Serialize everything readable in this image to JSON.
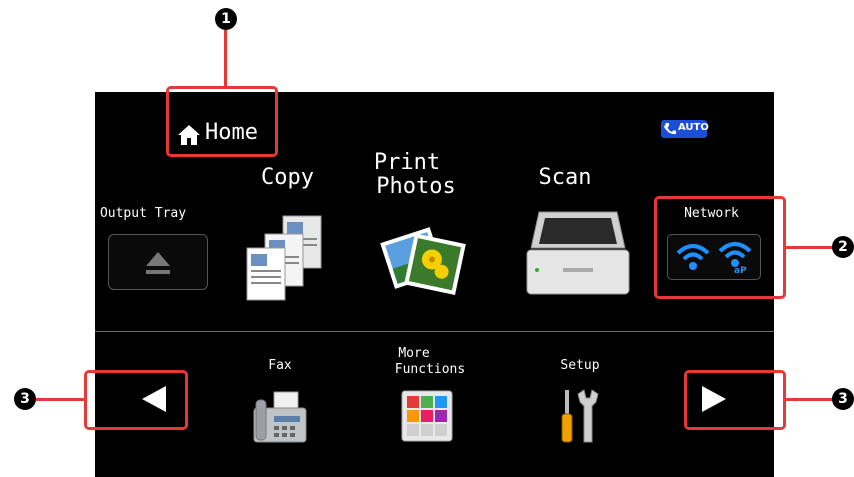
{
  "home": {
    "label": "Home"
  },
  "auto_badge": "AUTO",
  "output_tray": {
    "label": "Output Tray"
  },
  "copy": {
    "label": "Copy"
  },
  "print_photos": {
    "line1": "Print",
    "line2": "Photos"
  },
  "scan": {
    "label": "Scan"
  },
  "network": {
    "label": "Network",
    "ap_text": "aP"
  },
  "fax": {
    "label": "Fax"
  },
  "more_functions": {
    "line1": "More",
    "line2": "Functions"
  },
  "setup": {
    "label": "Setup"
  },
  "callouts": [
    "1",
    "2",
    "3",
    "3"
  ],
  "colors": {
    "screen": "#000000",
    "highlight": "#e53935",
    "wifi": "#1e90ff"
  }
}
